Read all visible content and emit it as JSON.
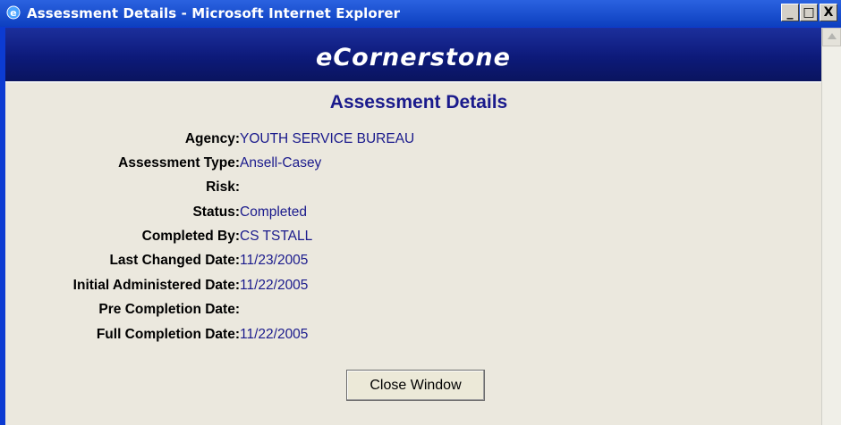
{
  "window": {
    "title": "Assessment Details - Microsoft Internet Explorer",
    "min_label": "_",
    "max_label": "□",
    "close_label": "X"
  },
  "banner": {
    "title": "eCornerstone"
  },
  "page": {
    "heading": "Assessment Details",
    "fields": [
      {
        "label": "Agency:",
        "value": "YOUTH SERVICE BUREAU"
      },
      {
        "label": "Assessment Type:",
        "value": "Ansell-Casey"
      },
      {
        "label": "Risk:",
        "value": ""
      },
      {
        "label": "Status:",
        "value": "Completed"
      },
      {
        "label": "Completed By:",
        "value": "CS TSTALL"
      },
      {
        "label": "Last Changed Date:",
        "value": "11/23/2005"
      },
      {
        "label": "Initial Administered Date:",
        "value": "11/22/2005"
      },
      {
        "label": "Pre Completion Date:",
        "value": ""
      },
      {
        "label": "Full Completion Date:",
        "value": "11/22/2005"
      }
    ],
    "close_button": "Close Window"
  }
}
